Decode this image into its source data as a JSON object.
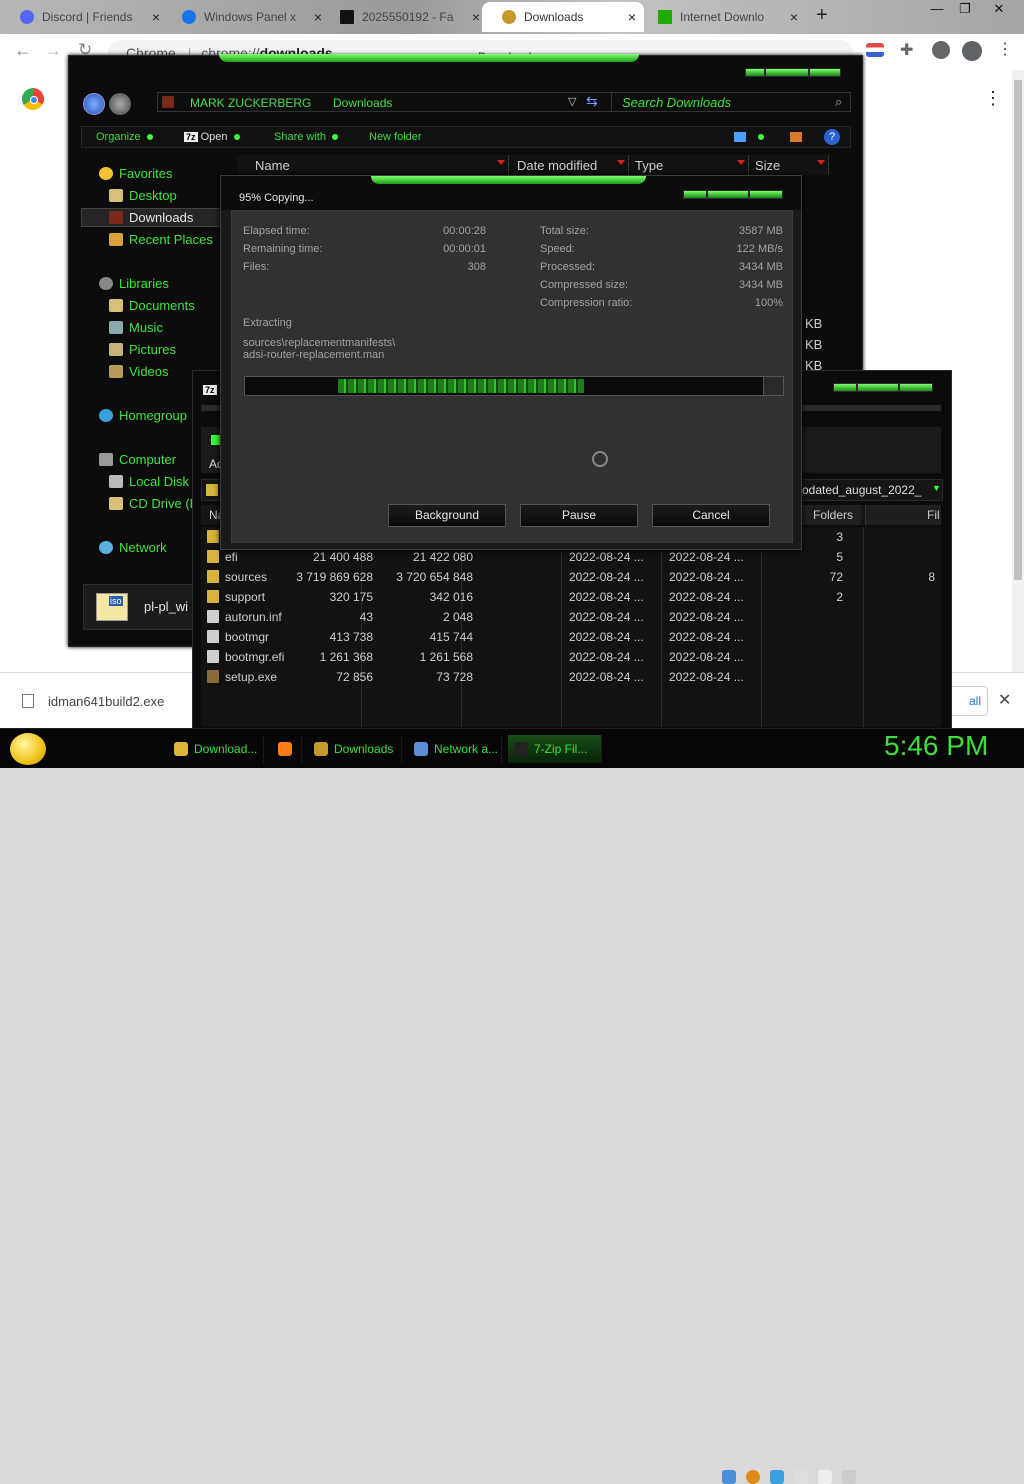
{
  "browser": {
    "tabs": [
      {
        "label": "Discord | Friends",
        "close": "×",
        "color": "#5865f2",
        "active": false
      },
      {
        "label": "Windows Panel x",
        "close": "×",
        "color": "#1a73e8",
        "active": false
      },
      {
        "label": "2025550192 - Fa",
        "close": "×",
        "color": "#111111",
        "active": false
      },
      {
        "label": "Downloads",
        "close": "×",
        "color": "#c49a2a",
        "active": true
      },
      {
        "label": "Internet Downlo",
        "close": "×",
        "color": "#1faa00",
        "active": false
      }
    ],
    "new_tab": "+",
    "window_controls": {
      "minimize": "—",
      "maximize": "❐",
      "close": "✕"
    },
    "omnibox": {
      "site_label": "Chrome",
      "url_prefix": "chrome://",
      "url_path": "downloads"
    },
    "page_title_fragment": "Downloads",
    "download_shelf": {
      "file_name": "idman641build2.exe",
      "show_all": "all",
      "close": "✕"
    }
  },
  "explorer": {
    "breadcrumb": [
      "MARK ZUCKERBERG",
      "Downloads"
    ],
    "search_placeholder": "Search Downloads",
    "commands": [
      "Organize",
      "Open",
      "Share with",
      "New folder"
    ],
    "open_badge": "7z",
    "nav": {
      "favorites": {
        "label": "Favorites",
        "items": [
          "Desktop",
          "Downloads",
          "Recent Places"
        ]
      },
      "libraries": {
        "label": "Libraries",
        "items": [
          "Documents",
          "Music",
          "Pictures",
          "Videos"
        ]
      },
      "homegroup": "Homegroup",
      "computer": {
        "label": "Computer",
        "items": [
          "Local Disk",
          "CD Drive (E"
        ]
      },
      "network": "Network"
    },
    "columns": [
      "Name",
      "Date modified",
      "Type",
      "Size"
    ],
    "size_fragments": [
      "KB",
      "KB",
      "KB"
    ],
    "iso_badge": "iso",
    "selected_file": "pl-pl_wi"
  },
  "copy_dialog": {
    "title": "95% Copying...",
    "left": [
      {
        "label": "Elapsed time:",
        "value": "00:00:28"
      },
      {
        "label": "Remaining time:",
        "value": "00:00:01"
      },
      {
        "label": "Files:",
        "value": "308"
      }
    ],
    "right": [
      {
        "label": "Total size:",
        "value": "3587 MB"
      },
      {
        "label": "Speed:",
        "value": "122 MB/s"
      },
      {
        "label": "Processed:",
        "value": "3434 MB"
      },
      {
        "label": "Compressed size:",
        "value": "3434 MB"
      },
      {
        "label": "Compression ratio:",
        "value": "100%"
      }
    ],
    "operation": "Extracting",
    "path_line1": "sources\\replacementmanifests\\",
    "path_line2": "adsi-router-replacement.man",
    "progress": 0.95,
    "buttons": {
      "background": "Background",
      "pause": "Pause",
      "cancel": "Cancel"
    }
  },
  "sevenzip_fm": {
    "title_badge": "7z",
    "toolbar_fragment": "Ad",
    "path_fragment": "odated_august_2022_",
    "columns": {
      "name": "Na",
      "folders": "Folders",
      "files": "Fil"
    },
    "rows": [
      {
        "name": "",
        "size": "",
        "packed": "",
        "modified": "",
        "created": "",
        "folders": "3",
        "files": "",
        "icon": "folder"
      },
      {
        "name": "efi",
        "size": "21 400 488",
        "packed": "21 422 080",
        "modified": "2022-08-24 ...",
        "created": "2022-08-24 ...",
        "folders": "5",
        "files": "",
        "icon": "folder"
      },
      {
        "name": "sources",
        "size": "3 719 869 628",
        "packed": "3 720 654 848",
        "modified": "2022-08-24 ...",
        "created": "2022-08-24 ...",
        "folders": "72",
        "files": "8",
        "icon": "folder"
      },
      {
        "name": "support",
        "size": "320 175",
        "packed": "342 016",
        "modified": "2022-08-24 ...",
        "created": "2022-08-24 ...",
        "folders": "2",
        "files": "",
        "icon": "folder"
      },
      {
        "name": "autorun.inf",
        "size": "43",
        "packed": "2 048",
        "modified": "2022-08-24 ...",
        "created": "2022-08-24 ...",
        "folders": "",
        "files": "",
        "icon": "file"
      },
      {
        "name": "bootmgr",
        "size": "413 738",
        "packed": "415 744",
        "modified": "2022-08-24 ...",
        "created": "2022-08-24 ...",
        "folders": "",
        "files": "",
        "icon": "file"
      },
      {
        "name": "bootmgr.efi",
        "size": "1 261 368",
        "packed": "1 261 568",
        "modified": "2022-08-24 ...",
        "created": "2022-08-24 ...",
        "folders": "",
        "files": "",
        "icon": "file"
      },
      {
        "name": "setup.exe",
        "size": "72 856",
        "packed": "73 728",
        "modified": "2022-08-24 ...",
        "created": "2022-08-24 ...",
        "folders": "",
        "files": "",
        "icon": "exe"
      }
    ]
  },
  "taskbar": {
    "items": [
      {
        "label": "Download...",
        "icon": "#e0b33a",
        "active": false
      },
      {
        "label": "",
        "icon": "#ff7a1a",
        "active": false
      },
      {
        "label": "Downloads",
        "icon": "#c49a2a",
        "active": false
      },
      {
        "label": "Network a...",
        "icon": "#5a8fd6",
        "active": false
      },
      {
        "label": "7-Zip Fil...",
        "icon": "#222222",
        "active": true
      }
    ],
    "clock": "5:46 PM"
  }
}
